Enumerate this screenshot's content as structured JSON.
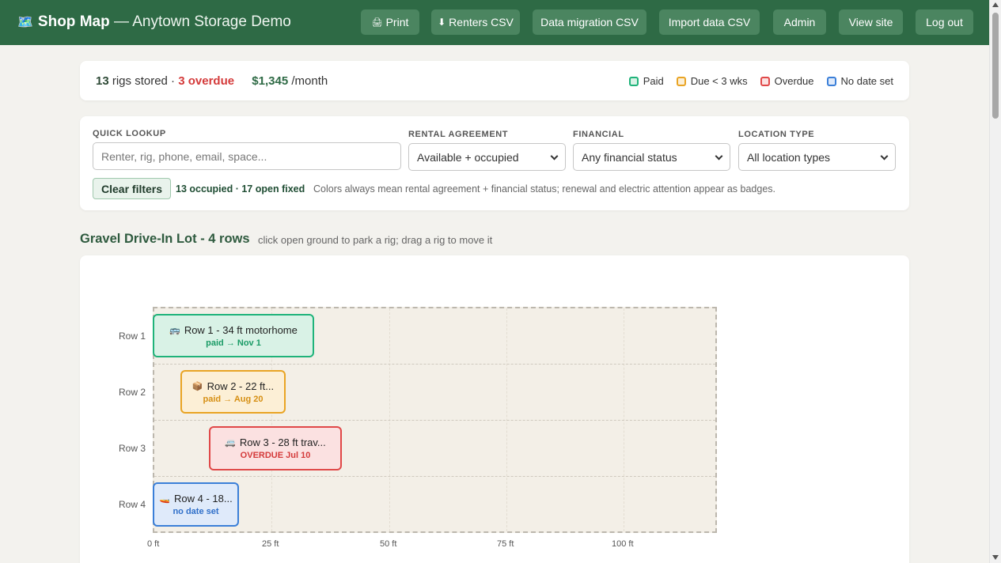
{
  "header": {
    "brand_icon": "map-icon",
    "brand_glyph": "🗺️",
    "app_name": "Shop Map",
    "site_name": "— Anytown Storage Demo",
    "buttons": [
      {
        "label": "Print",
        "icon": "printer-icon",
        "glyph": "🖨"
      },
      {
        "label": "Renters CSV",
        "icon": "download-icon",
        "glyph": "⬇"
      },
      {
        "label": "Data migration CSV"
      },
      {
        "label": "Import data CSV"
      },
      {
        "label": "Admin"
      },
      {
        "label": "View site"
      },
      {
        "label": "Log out"
      }
    ]
  },
  "summary": {
    "rigs_count": "13",
    "rigs_text": "rigs stored ·",
    "overdue": "3 overdue",
    "monthly": "$1,345",
    "monthly_suffix": "/month",
    "legend": [
      {
        "label": "Paid",
        "color": "#1fb37a",
        "fill": "#d9f2e6"
      },
      {
        "label": "Due < 3 wks",
        "color": "#e9a424",
        "fill": "#fcefd6"
      },
      {
        "label": "Overdue",
        "color": "#e04848",
        "fill": "#fbe1e1"
      },
      {
        "label": "No date set",
        "color": "#3b7fd8",
        "fill": "#dfeafa"
      }
    ]
  },
  "filters": {
    "lookup_label": "QUICK LOOKUP",
    "lookup_placeholder": "Renter, rig, phone, email, space...",
    "agreement_label": "RENTAL AGREEMENT",
    "agreement_value": "Available + occupied",
    "financial_label": "FINANCIAL",
    "financial_value": "Any financial status",
    "location_label": "LOCATION TYPE",
    "location_value": "All location types",
    "clear_label": "Clear filters",
    "occupancy": "13 occupied · 17 open fixed",
    "note": "Colors always mean rental agreement + financial status; renewal and electric attention appear as badges."
  },
  "lot": {
    "title": "Gravel Drive-In Lot - 4 rows",
    "hint": "click open ground to park a rig; drag a rig to move it",
    "rows": [
      "Row 1",
      "Row 2",
      "Row 3",
      "Row 4"
    ],
    "x_ticks": [
      "0 ft",
      "25 ft",
      "50 ft",
      "75 ft",
      "100 ft"
    ],
    "rigs": [
      {
        "name": "Row 1 - 34 ft motorhome",
        "status": "paid → Nov 1",
        "icon": "motorhome-icon",
        "glyph": "🚌",
        "state": "paid"
      },
      {
        "name": "Row 2 - 22 ft...",
        "status": "paid → Aug 20",
        "icon": "box-icon",
        "glyph": "📦",
        "state": "due"
      },
      {
        "name": "Row 3 - 28 ft trav...",
        "status": "OVERDUE Jul 10",
        "icon": "trailer-icon",
        "glyph": "🚐",
        "state": "overdue"
      },
      {
        "name": "Row 4 - 18...",
        "status": "no date set",
        "icon": "boat-icon",
        "glyph": "🚤",
        "state": "nodate"
      }
    ]
  }
}
